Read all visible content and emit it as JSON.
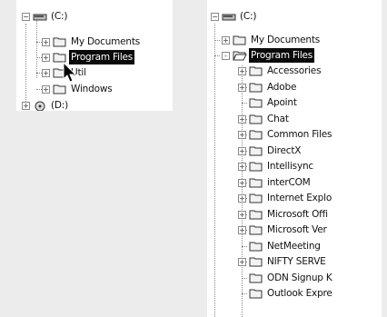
{
  "left_tree": {
    "header_label": "(C:)",
    "items": [
      {
        "label": "My Documents",
        "expander": "+"
      },
      {
        "label": "Program Files",
        "expander": "+"
      },
      {
        "label": "Util",
        "expander": "+"
      },
      {
        "label": "Windows",
        "expander": "+"
      }
    ],
    "drive_d_label": "(D:)",
    "drive_d_expander": "+"
  },
  "right_tree": {
    "header_label": "(C:)",
    "top_items": [
      {
        "label": "My Documents",
        "expander": "+"
      },
      {
        "label": "Program Files",
        "expander": "-"
      }
    ],
    "subitems": [
      {
        "label": "Accessories",
        "expander": "+"
      },
      {
        "label": "Adobe",
        "expander": "+"
      },
      {
        "label": "Apoint",
        "expander": ""
      },
      {
        "label": "Chat",
        "expander": "+"
      },
      {
        "label": "Common Files",
        "expander": "+"
      },
      {
        "label": "DirectX",
        "expander": "+"
      },
      {
        "label": "Intellisync",
        "expander": "+"
      },
      {
        "label": "interCOM",
        "expander": "+"
      },
      {
        "label": "Internet Explo",
        "expander": "+"
      },
      {
        "label": "Microsoft Offi",
        "expander": "+"
      },
      {
        "label": "Microsoft Ver",
        "expander": "+"
      },
      {
        "label": "NetMeeting",
        "expander": ""
      },
      {
        "label": "NIFTY SERVE",
        "expander": "+"
      },
      {
        "label": "ODN Signup K",
        "expander": ""
      },
      {
        "label": "Outlook Expre",
        "expander": ""
      }
    ]
  },
  "colors": {
    "selection_bg": "#0a0a0a",
    "selection_fg": "#ffffff",
    "folder_yellow": "#f2f2f2",
    "dotted_line": "#8a8a8a"
  },
  "icons": {
    "drive": "hard-drive-icon",
    "folder_closed": "folder-icon",
    "folder_open": "folder-open-icon",
    "cursor": "mouse-pointer-icon"
  }
}
